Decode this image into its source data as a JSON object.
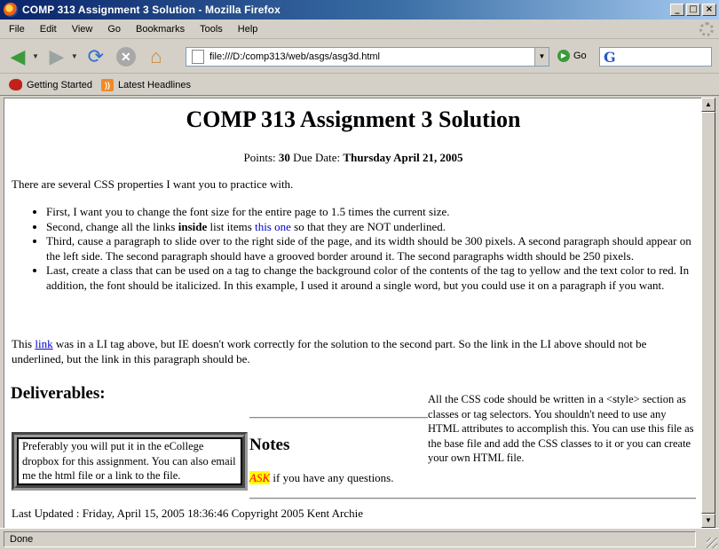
{
  "window": {
    "title": "COMP 313 Assignment 3 Solution - Mozilla Firefox",
    "min_glyph": "_",
    "max_glyph": "□",
    "close_glyph": "×"
  },
  "menu": [
    "File",
    "Edit",
    "View",
    "Go",
    "Bookmarks",
    "Tools",
    "Help"
  ],
  "nav": {
    "url": "file:///D:/comp313/web/asgs/asg3d.html",
    "go_label": "Go",
    "search_value": ""
  },
  "bookmarks": [
    "Getting Started",
    "Latest Headlines"
  ],
  "content": {
    "title": "COMP 313 Assignment 3 Solution",
    "points_label": "Points:",
    "points_value": "30",
    "due_label": "Due Date:",
    "due_value": "Thursday April 21, 2005",
    "intro": "There are several CSS properties I want you to practice with.",
    "item1": "First, I want you to change the font size for the entire page to 1.5 times the current size.",
    "item2_a": "Second, change all the links ",
    "item2_b": "inside",
    "item2_c": " list items ",
    "item2_link": "this one",
    "item2_d": " so that they are NOT underlined.",
    "item3": "Third, cause a paragraph to slide over to the right side of the page, and its width should be 300 pixels. A second paragraph should appear on the left side. The second paragraph should have a grooved border around it.  The second paragraphs width should be 250 pixels.",
    "item4": "Last, create a class that can be used on a tag to change the background color of the contents of the tag to yellow and the text color to red. In addition, the font should be italicized. In this example, I used it around a single word, but you could use it on a paragraph if you want.",
    "para_a": "This ",
    "para_link": "link",
    "para_b": " was in a LI tag above, but IE doesn't work correctly for the solution to the second part. So the link in the LI above should not be underlined, but the link in this paragraph should be.",
    "deliverables_heading": "Deliverables:",
    "right_para": "All the CSS code should be written in a <style> section as classes or tag selectors. You shouldn't need to use any HTML attributes to accomplish this. You can use this file as the base file and add the CSS classes to it or you can create your own HTML file.",
    "grooved_para": "Preferably you will put it in the eCollege dropbox for this assignment. You can also email me the html file or a link to the file.",
    "notes_heading": "Notes",
    "ask_word": "ASK",
    "ask_rest": " if you have any questions.",
    "updated": "Last Updated : Friday, April 15, 2005 18:36:46 Copyright 2005 Kent Archie"
  },
  "status": "Done",
  "colors": {
    "link": "#0000cc",
    "ask_bg": "#ffff00",
    "ask_fg": "#ff0000"
  }
}
